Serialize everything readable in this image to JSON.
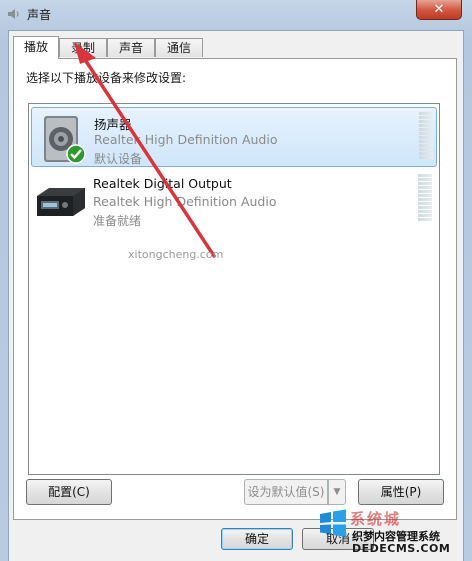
{
  "window": {
    "title": "声音",
    "close_glyph": "✕"
  },
  "tabs": [
    {
      "label": "播放",
      "active": true
    },
    {
      "label": "录制",
      "active": false
    },
    {
      "label": "声音",
      "active": false
    },
    {
      "label": "通信",
      "active": false
    }
  ],
  "panel": {
    "instruction": "选择以下播放设备来修改设置:"
  },
  "devices": [
    {
      "name": "扬声器",
      "description": "Realtek High Definition Audio",
      "status": "默认设备",
      "selected": true,
      "icon": "speaker-icon",
      "default_badge": "check-icon"
    },
    {
      "name": "Realtek Digital Output",
      "description": "Realtek High Definition Audio",
      "status": "准备就绪",
      "selected": false,
      "icon": "digital-output-icon"
    }
  ],
  "buttons": {
    "configure": "配置(C)",
    "set_default": "设为默认值(S)",
    "dropdown_glyph": "▼",
    "properties": "属性(P)",
    "ok": "确定",
    "cancel": "取消"
  },
  "watermark": {
    "brand": "系统城",
    "line1": "织梦内容管理系统",
    "line2": "DEDECMS.COM",
    "url": "xitongcheng.com"
  },
  "colors": {
    "selection": "#cfe6fb",
    "annotation_arrow": "#d9343b",
    "close_button": "#c8482f"
  }
}
